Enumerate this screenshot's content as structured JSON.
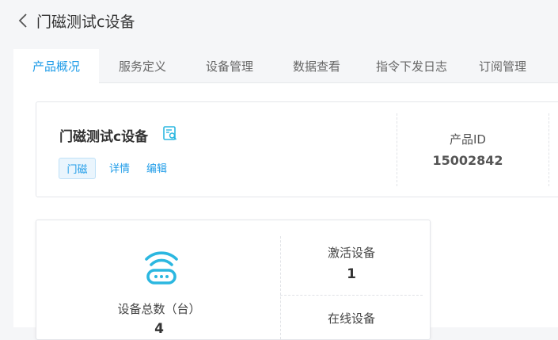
{
  "header": {
    "title": "门磁测试c设备",
    "back_icon": "chevron-left-icon"
  },
  "tabs": [
    {
      "label": "产品概况",
      "active": true
    },
    {
      "label": "服务定义"
    },
    {
      "label": "设备管理"
    },
    {
      "label": "数据查看"
    },
    {
      "label": "指令下发日志"
    },
    {
      "label": "订阅管理"
    }
  ],
  "product": {
    "name": "门磁测试c设备",
    "tag": "门磁",
    "detail_link": "详情",
    "edit_link": "编辑",
    "id_label": "产品ID",
    "id_value": "15002842"
  },
  "stats": {
    "total_label": "设备总数（台）",
    "total_value": "4",
    "activated_label": "激活设备",
    "activated_value": "1",
    "online_label": "在线设备"
  },
  "colors": {
    "accent": "#1f9ce8",
    "icon": "#2bb7e0"
  }
}
